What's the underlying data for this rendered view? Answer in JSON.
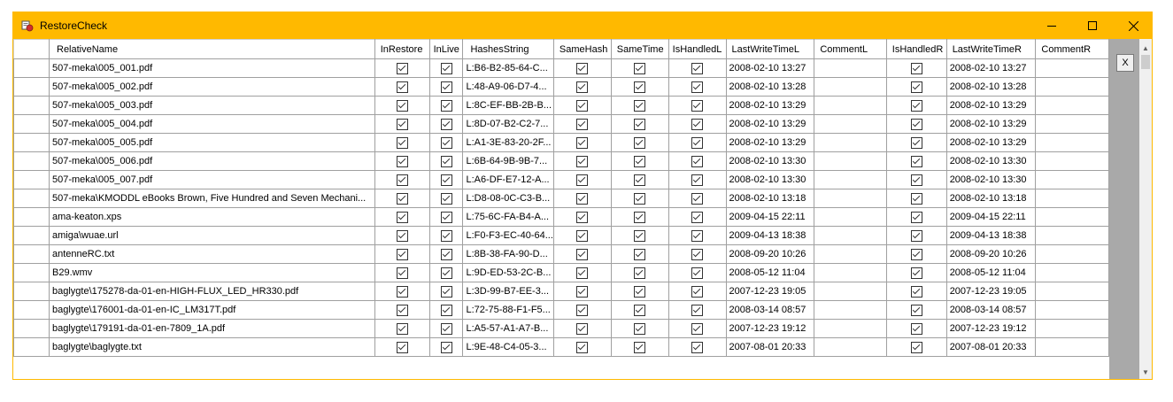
{
  "window": {
    "title": "RestoreCheck",
    "app_icon": "restore-check-app-icon",
    "controls": [
      "minimize-icon",
      "maximize-icon",
      "close-icon"
    ]
  },
  "colors": {
    "titlebar": "#ffb900",
    "gridlines": "#a0a0a0",
    "side_panel": "#a9a9a9"
  },
  "grid": {
    "columns": [
      "RelativeName",
      "InRestore",
      "InLive",
      "HashesString",
      "SameHash",
      "SameTime",
      "IsHandledL",
      "LastWriteTimeL",
      "CommentL",
      "IsHandledR",
      "LastWriteTimeR",
      "CommentR"
    ],
    "rows": [
      {
        "RelativeName": "507-meka\\005_001.pdf",
        "InRestore": true,
        "InLive": true,
        "HashesString": "L:B6-B2-85-64-C...",
        "SameHash": true,
        "SameTime": true,
        "IsHandledL": true,
        "LastWriteTimeL": "2008-02-10 13:27",
        "CommentL": "",
        "IsHandledR": true,
        "LastWriteTimeR": "2008-02-10 13:27",
        "CommentR": ""
      },
      {
        "RelativeName": "507-meka\\005_002.pdf",
        "InRestore": true,
        "InLive": true,
        "HashesString": "L:48-A9-06-D7-4...",
        "SameHash": true,
        "SameTime": true,
        "IsHandledL": true,
        "LastWriteTimeL": "2008-02-10 13:28",
        "CommentL": "",
        "IsHandledR": true,
        "LastWriteTimeR": "2008-02-10 13:28",
        "CommentR": ""
      },
      {
        "RelativeName": "507-meka\\005_003.pdf",
        "InRestore": true,
        "InLive": true,
        "HashesString": "L:8C-EF-BB-2B-B...",
        "SameHash": true,
        "SameTime": true,
        "IsHandledL": true,
        "LastWriteTimeL": "2008-02-10 13:29",
        "CommentL": "",
        "IsHandledR": true,
        "LastWriteTimeR": "2008-02-10 13:29",
        "CommentR": ""
      },
      {
        "RelativeName": "507-meka\\005_004.pdf",
        "InRestore": true,
        "InLive": true,
        "HashesString": "L:8D-07-B2-C2-7...",
        "SameHash": true,
        "SameTime": true,
        "IsHandledL": true,
        "LastWriteTimeL": "2008-02-10 13:29",
        "CommentL": "",
        "IsHandledR": true,
        "LastWriteTimeR": "2008-02-10 13:29",
        "CommentR": ""
      },
      {
        "RelativeName": "507-meka\\005_005.pdf",
        "InRestore": true,
        "InLive": true,
        "HashesString": "L:A1-3E-83-20-2F...",
        "SameHash": true,
        "SameTime": true,
        "IsHandledL": true,
        "LastWriteTimeL": "2008-02-10 13:29",
        "CommentL": "",
        "IsHandledR": true,
        "LastWriteTimeR": "2008-02-10 13:29",
        "CommentR": ""
      },
      {
        "RelativeName": "507-meka\\005_006.pdf",
        "InRestore": true,
        "InLive": true,
        "HashesString": "L:6B-64-9B-9B-7...",
        "SameHash": true,
        "SameTime": true,
        "IsHandledL": true,
        "LastWriteTimeL": "2008-02-10 13:30",
        "CommentL": "",
        "IsHandledR": true,
        "LastWriteTimeR": "2008-02-10 13:30",
        "CommentR": ""
      },
      {
        "RelativeName": "507-meka\\005_007.pdf",
        "InRestore": true,
        "InLive": true,
        "HashesString": "L:A6-DF-E7-12-A...",
        "SameHash": true,
        "SameTime": true,
        "IsHandledL": true,
        "LastWriteTimeL": "2008-02-10 13:30",
        "CommentL": "",
        "IsHandledR": true,
        "LastWriteTimeR": "2008-02-10 13:30",
        "CommentR": ""
      },
      {
        "RelativeName": "507-meka\\KMODDL  eBooks  Brown, Five Hundred and Seven Mechani...",
        "InRestore": true,
        "InLive": true,
        "HashesString": "L:D8-08-0C-C3-B...",
        "SameHash": true,
        "SameTime": true,
        "IsHandledL": true,
        "LastWriteTimeL": "2008-02-10 13:18",
        "CommentL": "",
        "IsHandledR": true,
        "LastWriteTimeR": "2008-02-10 13:18",
        "CommentR": ""
      },
      {
        "RelativeName": "ama-keaton.xps",
        "InRestore": true,
        "InLive": true,
        "HashesString": "L:75-6C-FA-B4-A...",
        "SameHash": true,
        "SameTime": true,
        "IsHandledL": true,
        "LastWriteTimeL": "2009-04-15 22:11",
        "CommentL": "",
        "IsHandledR": true,
        "LastWriteTimeR": "2009-04-15 22:11",
        "CommentR": ""
      },
      {
        "RelativeName": "amiga\\wuae.url",
        "InRestore": true,
        "InLive": true,
        "HashesString": "L:F0-F3-EC-40-64...",
        "SameHash": true,
        "SameTime": true,
        "IsHandledL": true,
        "LastWriteTimeL": "2009-04-13 18:38",
        "CommentL": "",
        "IsHandledR": true,
        "LastWriteTimeR": "2009-04-13 18:38",
        "CommentR": ""
      },
      {
        "RelativeName": "antenneRC.txt",
        "InRestore": true,
        "InLive": true,
        "HashesString": "L:8B-38-FA-90-D...",
        "SameHash": true,
        "SameTime": true,
        "IsHandledL": true,
        "LastWriteTimeL": "2008-09-20 10:26",
        "CommentL": "",
        "IsHandledR": true,
        "LastWriteTimeR": "2008-09-20 10:26",
        "CommentR": ""
      },
      {
        "RelativeName": "B29.wmv",
        "InRestore": true,
        "InLive": true,
        "HashesString": "L:9D-ED-53-2C-B...",
        "SameHash": true,
        "SameTime": true,
        "IsHandledL": true,
        "LastWriteTimeL": "2008-05-12 11:04",
        "CommentL": "",
        "IsHandledR": true,
        "LastWriteTimeR": "2008-05-12 11:04",
        "CommentR": ""
      },
      {
        "RelativeName": "baglygte\\175278-da-01-en-HIGH-FLUX_LED_HR330.pdf",
        "InRestore": true,
        "InLive": true,
        "HashesString": "L:3D-99-B7-EE-3...",
        "SameHash": true,
        "SameTime": true,
        "IsHandledL": true,
        "LastWriteTimeL": "2007-12-23 19:05",
        "CommentL": "",
        "IsHandledR": true,
        "LastWriteTimeR": "2007-12-23 19:05",
        "CommentR": ""
      },
      {
        "RelativeName": "baglygte\\176001-da-01-en-IC_LM317T.pdf",
        "InRestore": true,
        "InLive": true,
        "HashesString": "L:72-75-88-F1-F5...",
        "SameHash": true,
        "SameTime": true,
        "IsHandledL": true,
        "LastWriteTimeL": "2008-03-14 08:57",
        "CommentL": "",
        "IsHandledR": true,
        "LastWriteTimeR": "2008-03-14 08:57",
        "CommentR": ""
      },
      {
        "RelativeName": "baglygte\\179191-da-01-en-7809_1A.pdf",
        "InRestore": true,
        "InLive": true,
        "HashesString": "L:A5-57-A1-A7-B...",
        "SameHash": true,
        "SameTime": true,
        "IsHandledL": true,
        "LastWriteTimeL": "2007-12-23 19:12",
        "CommentL": "",
        "IsHandledR": true,
        "LastWriteTimeR": "2007-12-23 19:12",
        "CommentR": ""
      },
      {
        "RelativeName": "baglygte\\baglygte.txt",
        "InRestore": true,
        "InLive": true,
        "HashesString": "L:9E-48-C4-05-3...",
        "SameHash": true,
        "SameTime": true,
        "IsHandledL": true,
        "LastWriteTimeL": "2007-08-01 20:33",
        "CommentL": "",
        "IsHandledR": true,
        "LastWriteTimeR": "2007-08-01 20:33",
        "CommentR": ""
      }
    ]
  },
  "side_panel": {
    "close_label": "X"
  },
  "scrollbar": {
    "up_icon": "scroll-up-icon",
    "down_icon": "scroll-down-icon"
  }
}
